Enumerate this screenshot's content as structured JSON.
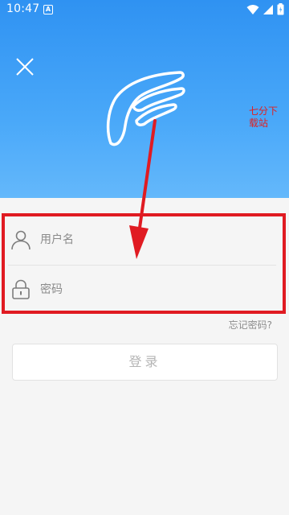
{
  "statusbar": {
    "time": "10:47",
    "notification_glyph": "A"
  },
  "header": {
    "close_icon": "close-icon",
    "logo_icon": "wing-logo-icon",
    "watermark": "七分下载站"
  },
  "form": {
    "username_placeholder": "用户名",
    "password_placeholder": "密码"
  },
  "forgot_password": "忘记密码?",
  "login_button": "登录",
  "colors": {
    "header_top": "#2f92f2",
    "header_bottom": "#64b8fb",
    "highlight_red": "#e01b22",
    "background": "#f5f5f5"
  }
}
